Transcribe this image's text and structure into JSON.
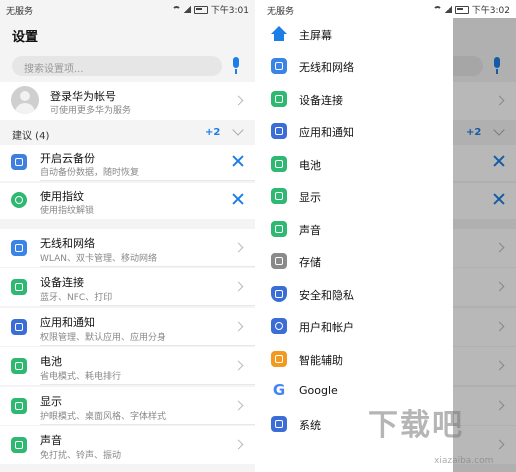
{
  "left": {
    "status": {
      "carrier": "无服务",
      "time": "下午3:01"
    },
    "title": "设置",
    "search_placeholder": "搜索设置项...",
    "account": {
      "title": "登录华为帐号",
      "subtitle": "可使用更多华为服务"
    },
    "suggestions": {
      "label": "建议 (4)",
      "count": "+2",
      "items": [
        {
          "title": "开启云备份",
          "subtitle": "自动备份数据，随时恢复",
          "icon": "cloud-backup-icon",
          "color": "#3f7fe0"
        },
        {
          "title": "使用指纹",
          "subtitle": "使用指纹解锁",
          "icon": "fingerprint-icon",
          "color": "#2eb872"
        }
      ]
    },
    "rows": [
      {
        "title": "无线和网络",
        "subtitle": "WLAN、双卡管理、移动网络",
        "icon": "wifi-icon",
        "color": "#3a84e6"
      },
      {
        "title": "设备连接",
        "subtitle": "蓝牙、NFC、打印",
        "icon": "device-connect-icon",
        "color": "#2eb872"
      },
      {
        "title": "应用和通知",
        "subtitle": "权限管理、默认应用、应用分身",
        "icon": "apps-icon",
        "color": "#3a6ed6"
      },
      {
        "title": "电池",
        "subtitle": "省电模式、耗电排行",
        "icon": "battery-icon",
        "color": "#2eb872"
      },
      {
        "title": "显示",
        "subtitle": "护眼模式、桌面风格、字体样式",
        "icon": "display-icon",
        "color": "#2eb872"
      },
      {
        "title": "声音",
        "subtitle": "免打扰、铃声、振动",
        "icon": "sound-icon",
        "color": "#2eb872"
      }
    ]
  },
  "right": {
    "status": {
      "carrier": "无服务",
      "time": "下午3:02"
    },
    "badge": "+2",
    "drawer": [
      {
        "label": "主屏幕",
        "icon": "home-icon",
        "color": "#1e7ee8"
      },
      {
        "label": "无线和网络",
        "icon": "wifi-icon",
        "color": "#3a84e6"
      },
      {
        "label": "设备连接",
        "icon": "device-connect-icon",
        "color": "#2eb872"
      },
      {
        "label": "应用和通知",
        "icon": "apps-icon",
        "color": "#3a6ed6"
      },
      {
        "label": "电池",
        "icon": "battery-icon",
        "color": "#2eb872"
      },
      {
        "label": "显示",
        "icon": "display-icon",
        "color": "#2eb872"
      },
      {
        "label": "声音",
        "icon": "sound-icon",
        "color": "#2eb872"
      },
      {
        "label": "存储",
        "icon": "storage-icon",
        "color": "#8a8a8a"
      },
      {
        "label": "安全和隐私",
        "icon": "shield-icon",
        "color": "#3a6ed6"
      },
      {
        "label": "用户和帐户",
        "icon": "user-icon",
        "color": "#3a6ed6"
      },
      {
        "label": "智能辅助",
        "icon": "hand-icon",
        "color": "#f29a1f"
      },
      {
        "label": "Google",
        "icon": "google-icon",
        "color": "#4285f4"
      },
      {
        "label": "系统",
        "icon": "system-icon",
        "color": "#3a6ed6"
      }
    ]
  },
  "watermark": {
    "main": "下载吧",
    "sub": "xiazaiba.com"
  }
}
